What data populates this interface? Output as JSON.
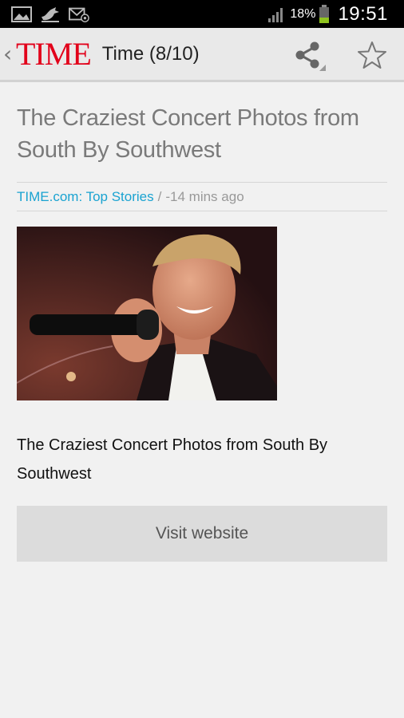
{
  "status_bar": {
    "battery_percent": "18%",
    "time": "19:51",
    "icons": [
      "gallery-icon",
      "bird-icon",
      "email-icon",
      "signal-icon",
      "battery-icon"
    ]
  },
  "action_bar": {
    "back_chevron": "‹",
    "logo": "TIME",
    "title": "Time (8/10)",
    "icons": [
      "share-icon",
      "star-icon"
    ]
  },
  "article": {
    "headline": "The Craziest Concert Photos from South By Southwest",
    "source": "TIME.com: Top Stories",
    "separator": "/",
    "time_ago": "-14 mins ago",
    "body": "The Craziest Concert Photos from South By Southwest",
    "visit_button": "Visit website"
  },
  "colors": {
    "accent": "#1aa3d1",
    "logo_red": "#e2001a",
    "background": "#f1f1f1",
    "headline": "#7a7a7a"
  }
}
